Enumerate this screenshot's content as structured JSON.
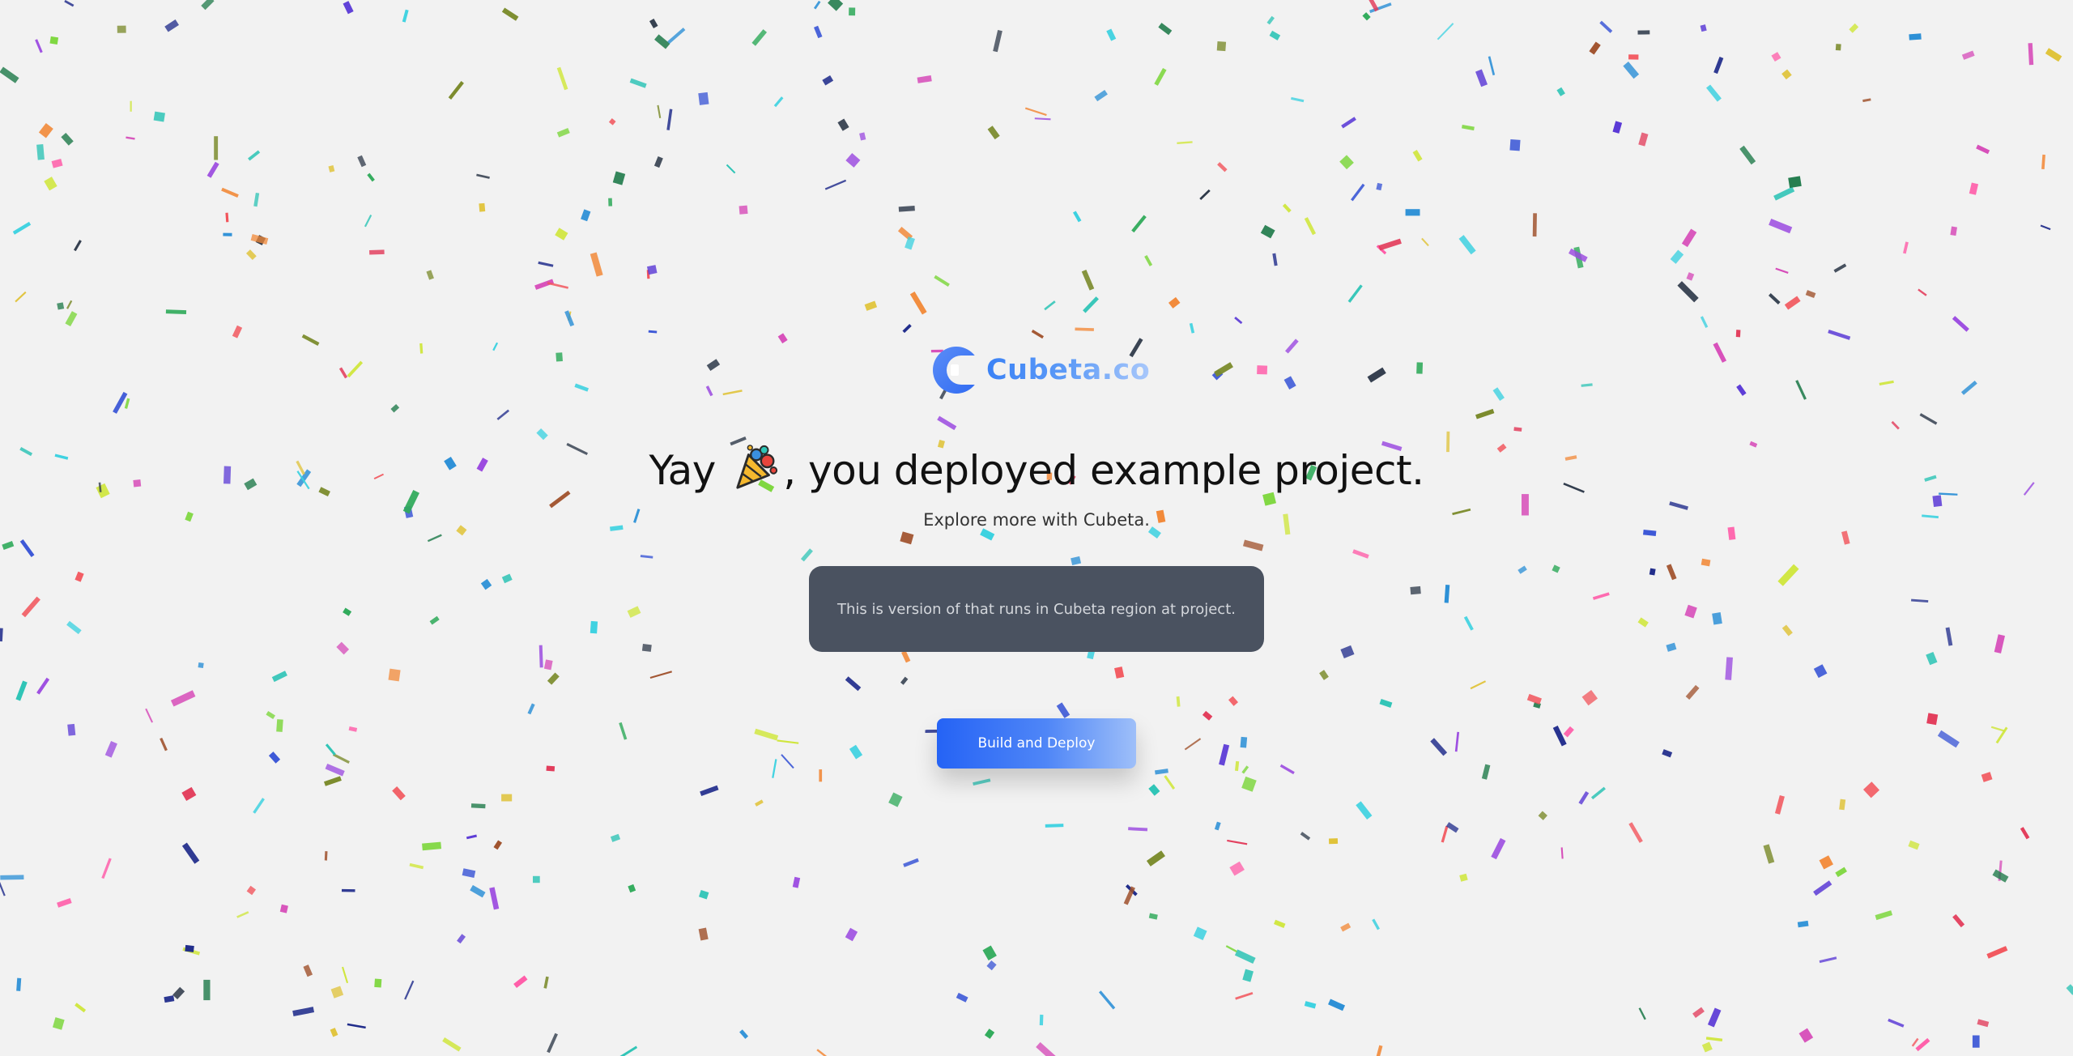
{
  "brand": {
    "logo_icon": "cubeta-c-logo-icon",
    "name": "Cubeta.co",
    "accent": "#3b82f6"
  },
  "hero": {
    "headline_before": "Yay",
    "headline_icon": "party-popper-icon",
    "headline_after": ", you deployed example project.",
    "subtitle": "Explore more with Cubeta."
  },
  "info_box": {
    "text": "This is version of that runs in Cubeta region at project.",
    "background": "#4a5260"
  },
  "actions": {
    "deploy_label": "Build and Deploy",
    "deploy_color": "#2563f5"
  },
  "confetti": {
    "icon": "confetti-pieces",
    "palette": [
      "#e23b5a",
      "#f2545b",
      "#f28a3a",
      "#e0c33a",
      "#cfe63a",
      "#7bd63a",
      "#2faa5a",
      "#1f7a4a",
      "#2ec4b6",
      "#3bd1e0",
      "#2b8fd6",
      "#3a56d6",
      "#5b3ad6",
      "#9b4ae0",
      "#d64ab8",
      "#ff5ca8",
      "#a0522d",
      "#7a8a2a",
      "#1e2a8a",
      "#2f3a4a"
    ]
  }
}
